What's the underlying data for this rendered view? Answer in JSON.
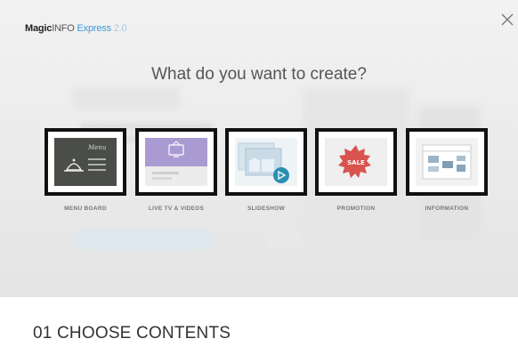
{
  "header": {
    "logo": {
      "magic": "Magic",
      "info": "INFO",
      "express": "Express",
      "version": "2.0"
    },
    "close_icon": "close-icon"
  },
  "main": {
    "title": "What do you want to create?",
    "options": [
      {
        "id": "menu-board",
        "label": "MENU BOARD",
        "icon": "menu-board-icon",
        "thumb_text": "Menu"
      },
      {
        "id": "live-tv",
        "label": "LIVE TV & VIDEOS",
        "icon": "tv-icon"
      },
      {
        "id": "slideshow",
        "label": "SLIDESHOW",
        "icon": "slideshow-icon"
      },
      {
        "id": "promotion",
        "label": "PROMOTION",
        "icon": "sale-badge-icon",
        "thumb_text": "SALE"
      },
      {
        "id": "information",
        "label": "INFORMATION",
        "icon": "info-board-icon"
      }
    ]
  },
  "footer": {
    "step": "01 CHOOSE CONTENTS"
  },
  "colors": {
    "accent": "#3a9ad9",
    "tile_border": "#111111",
    "sale": "#d9534f",
    "tv_purple": "#a99bd1",
    "menu_dark": "#4a4d48"
  }
}
